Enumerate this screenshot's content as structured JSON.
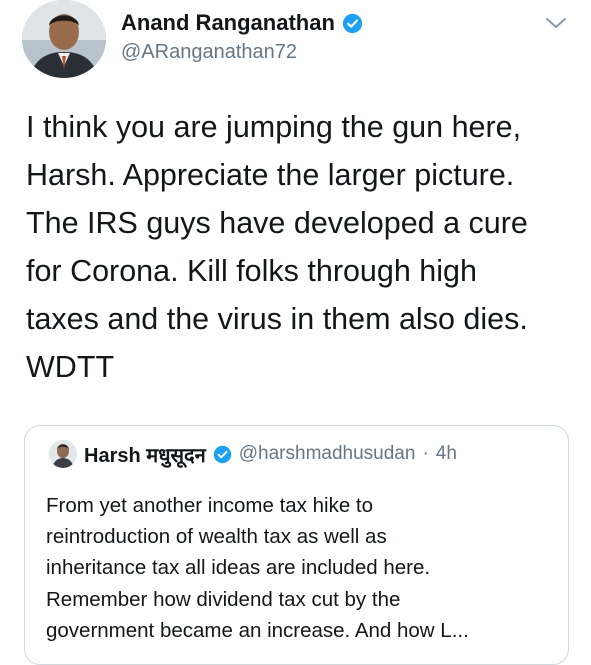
{
  "author": {
    "display_name": "Anand Ranganathan",
    "handle": "@ARanganathan72",
    "verified": true
  },
  "menu_icon": "chevron-down-icon",
  "tweet": {
    "lines": [
      "I think you are jumping the gun here,",
      "Harsh. Appreciate the larger picture.",
      "The IRS guys have developed a cure",
      "for Corona. Kill folks through high",
      "taxes and the virus in them also dies.",
      "WDTT"
    ]
  },
  "quoted_tweet": {
    "display_name": "Harsh मधुसूदन",
    "verified": true,
    "handle": "@harshmadhusudan",
    "separator": "·",
    "time": "4h",
    "lines": [
      "From yet another income tax hike to",
      "reintroduction of wealth tax as well as",
      "inheritance tax all ideas are included here.",
      "Remember how dividend tax cut by the",
      "government became an increase. And how L..."
    ]
  },
  "colors": {
    "verified_blue": "#1da1f2",
    "secondary_text": "#657786",
    "primary_text": "#14171a",
    "card_border": "#cfd9de"
  }
}
